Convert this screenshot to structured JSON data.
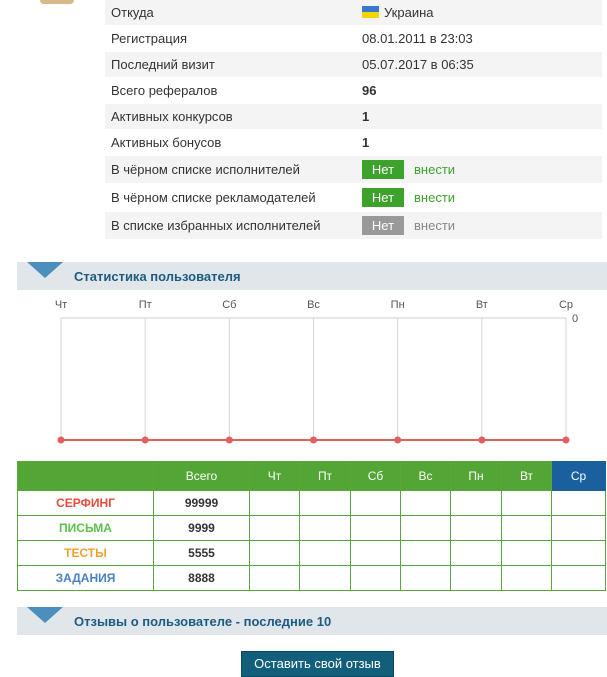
{
  "profile": {
    "rows": [
      {
        "label": "Откуда",
        "value": "Украина"
      },
      {
        "label": "Регистрация",
        "value": "08.01.2011 в 23:03"
      },
      {
        "label": "Последний визит",
        "value": "05.07.2017 в 06:35"
      },
      {
        "label": "Всего рефералов",
        "value": "96"
      },
      {
        "label": "Активных конкурсов",
        "value": "1"
      },
      {
        "label": "Активных бонусов",
        "value": "1"
      }
    ],
    "lists": [
      {
        "label": "В чёрном списке исполнителей",
        "status": "Нет",
        "action": "внести",
        "color": "#3ca22c"
      },
      {
        "label": "В чёрном списке рекламодателей",
        "status": "Нет",
        "action": "внести",
        "color": "#3ca22c"
      },
      {
        "label": "В списке избранных исполнителей",
        "status": "Нет",
        "action": "внести",
        "color": "#999999"
      }
    ]
  },
  "stats_section": {
    "title": "Статистика пользователя"
  },
  "chart_data": {
    "type": "line",
    "categories": [
      "Чт",
      "Пт",
      "Сб",
      "Вс",
      "Пн",
      "Вт",
      "Ср"
    ],
    "series": [
      {
        "values": [
          0,
          0,
          0,
          0,
          0,
          0,
          0
        ],
        "color": "#e06060"
      }
    ],
    "y_tick_label": "0",
    "grid": true
  },
  "stats_table": {
    "headers": [
      "",
      "Всего",
      "Чт",
      "Пт",
      "Сб",
      "Вс",
      "Пн",
      "Вт",
      "Ср"
    ],
    "rows": [
      {
        "name": "СЕРФИНГ",
        "total": "99999",
        "color": "#e64b3b"
      },
      {
        "name": "ПИСЬМА",
        "total": "9999",
        "color": "#5cc24a"
      },
      {
        "name": "ТЕСТЫ",
        "total": "5555",
        "color": "#f0a030"
      },
      {
        "name": "ЗАДАНИЯ",
        "total": "8888",
        "color": "#4a7fc0"
      }
    ]
  },
  "reviews_section": {
    "title": "Отзывы о пользователе - последние 10"
  },
  "review_button": {
    "label": "Оставить свой отзыв"
  }
}
